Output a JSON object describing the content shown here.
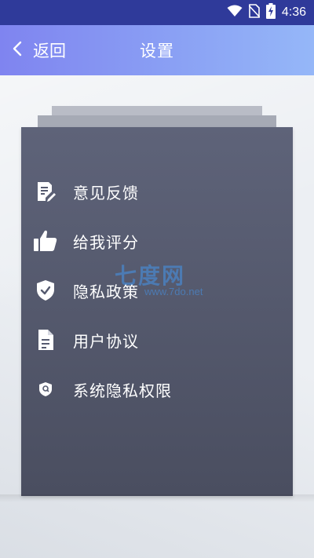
{
  "status_bar": {
    "time": "4:36",
    "icons": [
      "wifi-icon",
      "no-sim-icon",
      "battery-charging-icon"
    ]
  },
  "header": {
    "back_label": "返回",
    "title": "设置",
    "gradient_colors": [
      "#7f84f0",
      "#95b7f8"
    ]
  },
  "menu": {
    "items": [
      {
        "label": "意见反馈",
        "icon": "feedback-icon"
      },
      {
        "label": "给我评分",
        "icon": "thumbs-up-icon"
      },
      {
        "label": "隐私政策",
        "icon": "shield-check-icon"
      },
      {
        "label": "用户协议",
        "icon": "document-icon"
      },
      {
        "label": "系统隐私权限",
        "icon": "shield-search-icon"
      }
    ]
  },
  "watermark": {
    "title": "七度网",
    "url": "www.7do.net"
  },
  "colors": {
    "status_bar": "#2f3a9a",
    "card_top": "#5e6379",
    "card_bottom": "#4a4e60",
    "text": "#ffffff"
  }
}
